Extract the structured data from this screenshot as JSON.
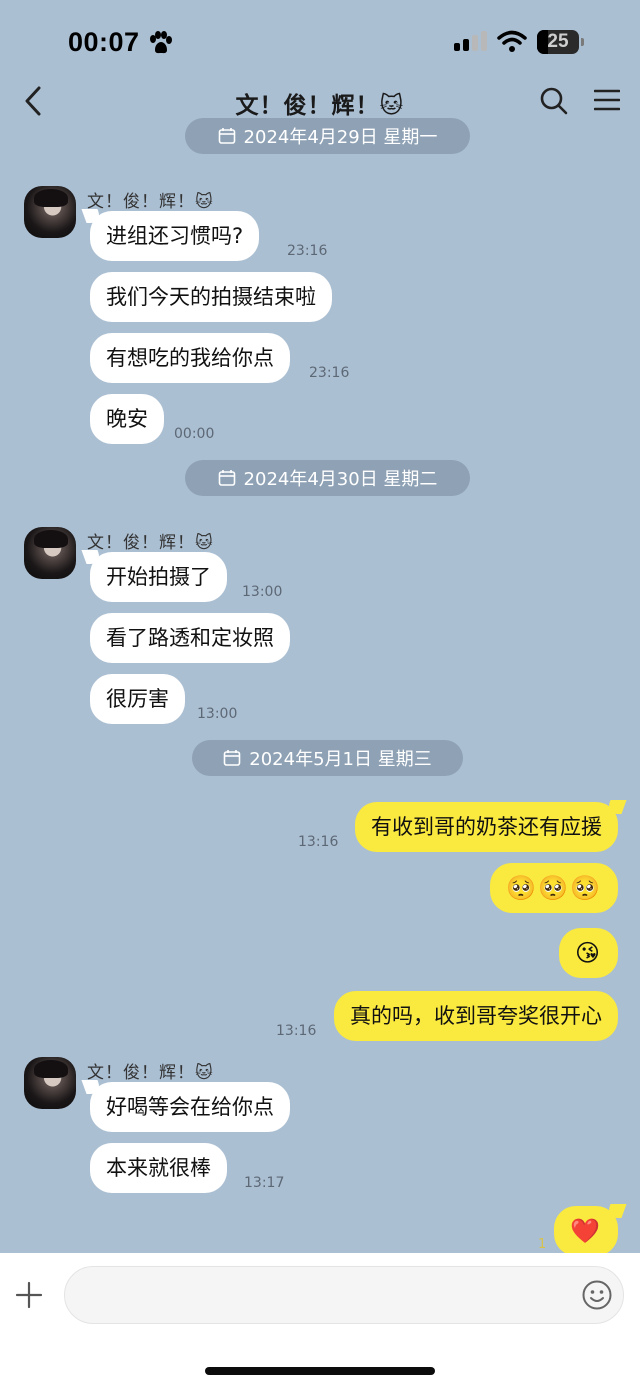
{
  "status_bar": {
    "time": "00:07",
    "battery": "25",
    "battery_level": 0.25
  },
  "nav": {
    "title": "文！俊！辉！🐱"
  },
  "dates": {
    "d1": "2024年4月29日 星期一",
    "d2": "2024年4月30日 星期二",
    "d3": "2024年5月1日 星期三"
  },
  "contact": {
    "name": "文！俊！辉！🐱"
  },
  "messages": {
    "m1": {
      "text": "进组还习惯吗?",
      "time": "23:16"
    },
    "m2": {
      "text": "我们今天的拍摄结束啦"
    },
    "m3": {
      "text": "有想吃的我给你点",
      "time": "23:16"
    },
    "m4": {
      "text": "晚安",
      "time": "00:00"
    },
    "m5": {
      "text": "开始拍摄了",
      "time": "13:00"
    },
    "m6": {
      "text": "看了路透和定妆照"
    },
    "m7": {
      "text": "很厉害",
      "time": "13:00"
    },
    "m8": {
      "text": "有收到哥的奶茶还有应援",
      "time": "13:16"
    },
    "m9": {
      "text": "🥺🥺🥺"
    },
    "m10": {
      "text": "😘"
    },
    "m11": {
      "text": "真的吗，收到哥夸奖很开心",
      "time": "13:16"
    },
    "m12": {
      "text": "好喝等会在给你点"
    },
    "m13": {
      "text": "本来就很棒",
      "time": "13:17"
    },
    "m14": {
      "text": "❤️",
      "unread": "1"
    }
  },
  "input": {
    "placeholder": "",
    "value": ""
  },
  "colors": {
    "background": "#abbfd3",
    "incoming_bubble": "#ffffff",
    "outgoing_bubble": "#fae93e",
    "date_pill": "#8fa2b5"
  },
  "icons": [
    "paw-icon",
    "signal-icon",
    "wifi-icon",
    "back-icon",
    "search-icon",
    "menu-icon",
    "calendar-icon",
    "plus-icon",
    "emoji-icon"
  ]
}
